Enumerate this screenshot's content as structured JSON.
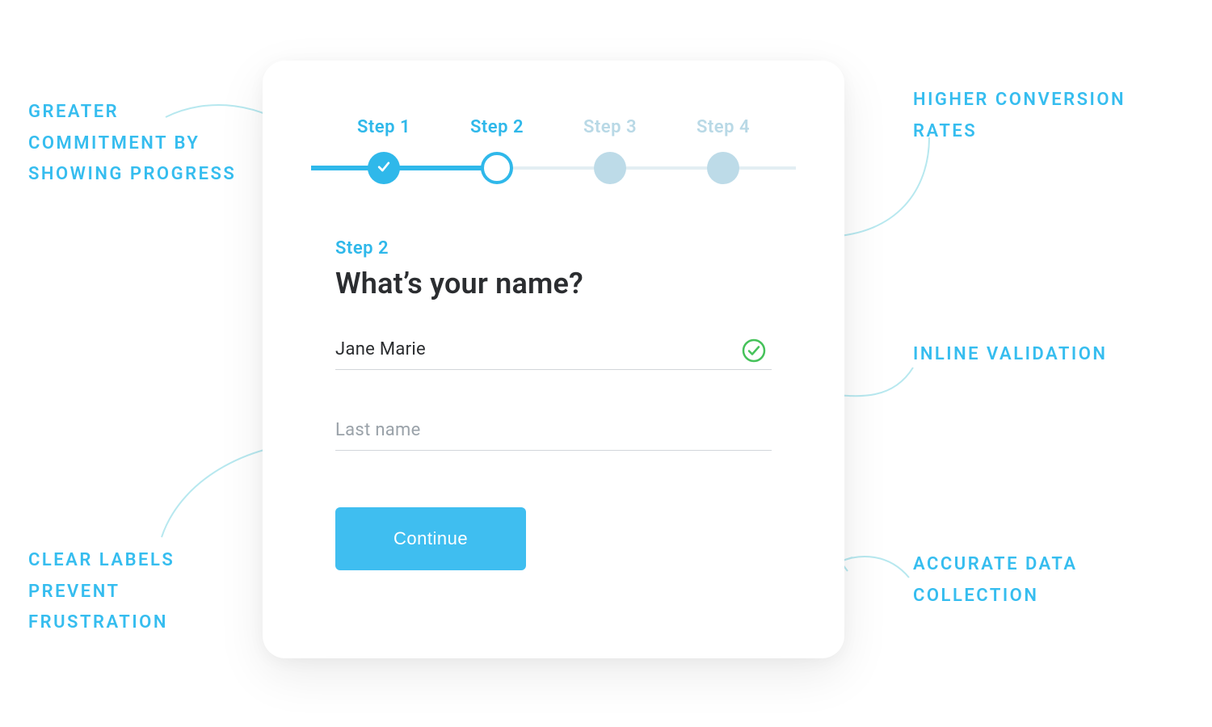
{
  "stepper": {
    "steps": [
      {
        "label": "Step 1",
        "state": "done"
      },
      {
        "label": "Step 2",
        "state": "current"
      },
      {
        "label": "Step 3",
        "state": "pending"
      },
      {
        "label": "Step 4",
        "state": "pending"
      }
    ]
  },
  "section": {
    "label": "Step 2",
    "title": "What’s your name?"
  },
  "fields": {
    "first_name_value": "Jane Marie",
    "first_name_valid_icon": "check-circle-icon",
    "last_name_placeholder": "Last name"
  },
  "button": {
    "continue_label": "Continue"
  },
  "annotations": {
    "top_left": "GREATER COMMITMENT BY SHOWING PROGRESS",
    "bottom_left": "CLEAR LABELS PREVENT FRUSTRATION",
    "top_right": "HIGHER CONVERSION RATES",
    "mid_right": "INLINE VALIDATION",
    "bottom_right": "ACCURATE DATA COLLECTION"
  },
  "colors": {
    "accent": "#2fb8ea",
    "button": "#3fbef0",
    "valid": "#46c25a"
  }
}
